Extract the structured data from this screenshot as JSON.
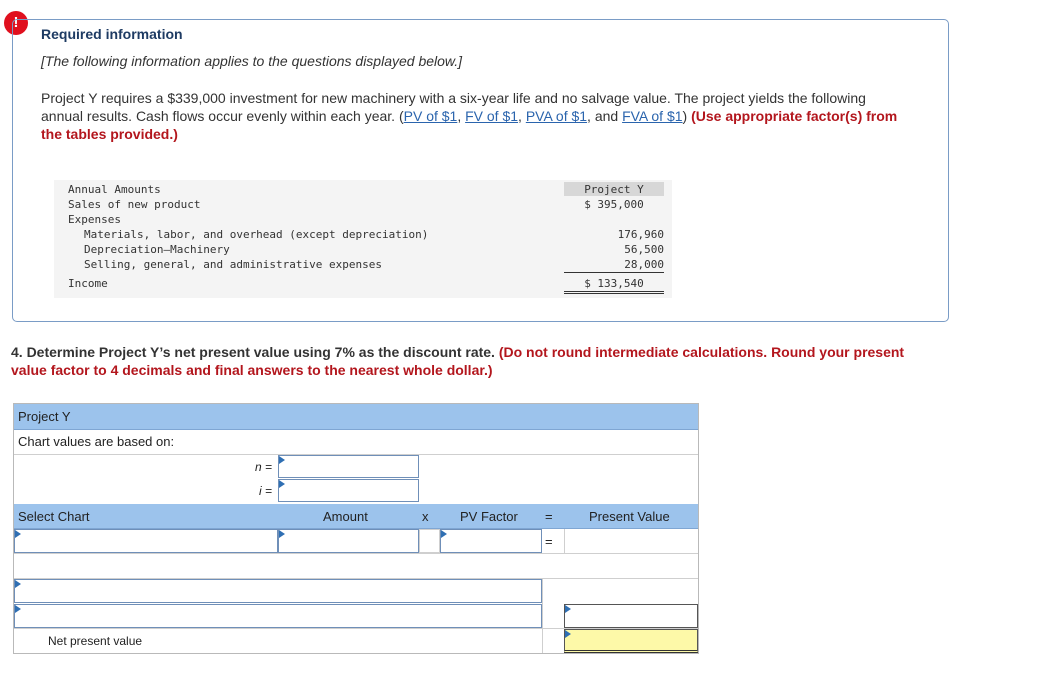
{
  "alert_icon": "!",
  "info": {
    "title": "Required information",
    "subtitle": "[The following information applies to the questions displayed below.]",
    "body_text": "Project Y requires a $339,000 investment for new machinery with a six-year life and no salvage value. The project yields the following annual results. Cash flows occur evenly within each year. (",
    "links": [
      "PV of $1",
      "FV of $1",
      "PVA of $1",
      "FVA of $1"
    ],
    "link_sep": ", ",
    "link_and": ", and ",
    "body_close": ") ",
    "red_note": "(Use appropriate factor(s) from the tables provided.)"
  },
  "annual_table": {
    "header_label": "Annual Amounts",
    "header_value": "Project Y",
    "rows": [
      {
        "label": "Sales of new product",
        "value": "$ 395,000"
      },
      {
        "label": "Expenses",
        "value": ""
      },
      {
        "label": "Materials, labor, and overhead (except depreciation)",
        "value": "176,960"
      },
      {
        "label": "Depreciation—Machinery",
        "value": "56,500"
      },
      {
        "label": "Selling, general, and administrative expenses",
        "value": "28,000"
      },
      {
        "label": "Income",
        "value": "$ 133,540"
      }
    ]
  },
  "question": {
    "number_text": "4. Determine Project Y’s net present value using 7% as the discount rate. ",
    "red_text": "(Do not round intermediate calculations. Round your present value factor to 4 decimals and final answers to the nearest whole dollar.)"
  },
  "worksheet": {
    "title": "Project Y",
    "chart_basis_label": "Chart values are based on:",
    "n_label": "n =",
    "i_label": "i =",
    "col_select": "Select Chart",
    "col_amount": "Amount",
    "col_x": "x",
    "col_factor": "PV Factor",
    "col_eq": "=",
    "col_pv": "Present Value",
    "row_eq": "=",
    "npv_label": "Net present value"
  }
}
